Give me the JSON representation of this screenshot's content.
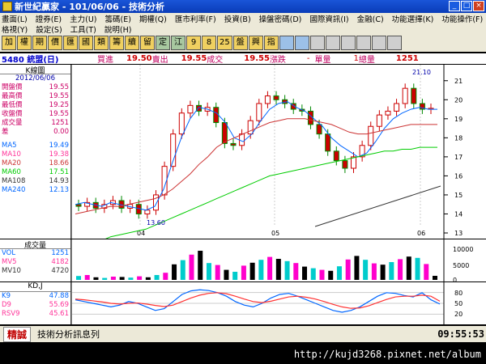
{
  "window": {
    "title": "新世紀贏家 - 101/06/06 - 技術分析"
  },
  "menu": {
    "row1": [
      "畫面(L)",
      "證券(E)",
      "主力(U)",
      "籌碼(E)",
      "期權(Q)",
      "匯市利率(F)",
      "投資(B)",
      "操盤密碼(D)",
      "國際資訊(I)",
      "金融(C)",
      "功能選擇(K)",
      "功能操作(F)"
    ],
    "row2": [
      "格視(Y)",
      "設定(S)",
      "工具(T)",
      "說明(H)"
    ]
  },
  "toolbar": {
    "buttons": [
      "加",
      "權",
      "期",
      "價",
      "匯",
      "國",
      "類",
      "籌",
      "續",
      "留",
      "定",
      "江",
      "9",
      "8",
      "25",
      "盤",
      "興",
      "指"
    ]
  },
  "quote": {
    "code_name": "5480 統盟(日)",
    "buy_label": "買進",
    "buy": "19.50",
    "sell_label": "賣出",
    "sell": "19.55",
    "trade_label": "成交",
    "trade": "19.55",
    "change_label": "漲跌",
    "change": "-",
    "unit_label": "單量",
    "unit": "1",
    "total_label": "總量",
    "total": "1251"
  },
  "kline": {
    "header": "K線圖",
    "date": "2012/06/06",
    "fields": [
      {
        "label": "開盤價",
        "value": "19.55"
      },
      {
        "label": "最高價",
        "value": "19.55"
      },
      {
        "label": "最低價",
        "value": "19.25"
      },
      {
        "label": "收盤價",
        "value": "19.55"
      },
      {
        "label": "成交量",
        "value": "1251"
      },
      {
        "label": "差",
        "value": "0.00"
      }
    ],
    "ma": [
      {
        "label": "MA5",
        "value": "19.49",
        "color": "#0066ff"
      },
      {
        "label": "MA10",
        "value": "19.38",
        "color": "#ff3399"
      },
      {
        "label": "MA20",
        "value": "18.66",
        "color": "#cc3333"
      },
      {
        "label": "MA60",
        "value": "17.51",
        "color": "#00cc00"
      },
      {
        "label": "MA108",
        "value": "14.93",
        "color": "#333333"
      },
      {
        "label": "MA240",
        "value": "12.13",
        "color": "#0066ff"
      }
    ],
    "high_label": "21.10",
    "low_label": "13.60",
    "month_labels": [
      "04",
      "05",
      "06"
    ],
    "y_ticks": [
      "21",
      "20",
      "19",
      "18",
      "17",
      "16",
      "15",
      "14",
      "13"
    ]
  },
  "volume": {
    "header": "成交量",
    "fields": [
      {
        "label": "VOL",
        "value": "1251",
        "color": "#0066ff"
      },
      {
        "label": "MV5",
        "value": "4182",
        "color": "#ff3399"
      },
      {
        "label": "MV10",
        "value": "4720",
        "color": "#333333"
      }
    ],
    "y_ticks": [
      "10000",
      "5000",
      "0"
    ]
  },
  "kd": {
    "header": "KD,J",
    "fields": [
      {
        "label": "K9",
        "value": "47.88",
        "color": "#0066ff"
      },
      {
        "label": "D9",
        "value": "55.69",
        "color": "#ff3399"
      },
      {
        "label": "RSV9",
        "value": "45.61",
        "color": "#ff3399"
      }
    ],
    "y_ticks": [
      "80",
      "50",
      "20"
    ]
  },
  "status": {
    "seal": "精誠",
    "message": "技術分析訊息列",
    "time": "09:55:53"
  },
  "watermark": "http://kujd3268.pixnet.net/album",
  "chart_data": {
    "type": "line",
    "title": "",
    "x": [
      1,
      2,
      3,
      4,
      5,
      6,
      7,
      8,
      9,
      10,
      11,
      12,
      13,
      14,
      15,
      16,
      17,
      18,
      19,
      20,
      21,
      22,
      23,
      24,
      25,
      26,
      27,
      28,
      29,
      30,
      31,
      32,
      33,
      34,
      35,
      36,
      37,
      38,
      39,
      40,
      41,
      42,
      43,
      44,
      45,
      46,
      47,
      48,
      49,
      50
    ],
    "series": [
      {
        "name": "MA5",
        "values": [
          14.5,
          14.6,
          14.5,
          14.4,
          14.6,
          14.5,
          14.4,
          14.3,
          14.2,
          14.4,
          15.3,
          16.7,
          18.0,
          19.0,
          19.6,
          19.5,
          19.3,
          18.8,
          18.0,
          17.8,
          18.2,
          18.9,
          19.5,
          19.8,
          19.9,
          19.6,
          19.4,
          19.0,
          18.6,
          18.0,
          17.6,
          17.3,
          17.0,
          17.2,
          17.8,
          18.5,
          19.0,
          19.3,
          19.5,
          19.6,
          19.5,
          19.5
        ]
      },
      {
        "name": "MA20",
        "values": [
          14.0,
          14.1,
          14.2,
          14.3,
          14.4,
          14.4,
          14.5,
          14.6,
          14.7,
          14.8,
          15.0,
          15.3,
          15.7,
          16.1,
          16.6,
          17.0,
          17.5,
          17.8,
          18.0,
          18.2,
          18.4,
          18.6,
          18.8,
          18.9,
          19.0,
          19.0,
          19.0,
          18.9,
          18.8,
          18.7,
          18.5,
          18.3,
          18.2,
          18.2,
          18.3,
          18.4,
          18.5,
          18.6,
          18.7,
          18.7,
          18.7,
          18.7
        ]
      },
      {
        "name": "MA60",
        "values": [
          12.3,
          12.4,
          12.5,
          12.6,
          12.8,
          12.9,
          13.0,
          13.1,
          13.2,
          13.4,
          13.6,
          13.8,
          14.0,
          14.2,
          14.4,
          14.6,
          14.8,
          15.0,
          15.2,
          15.4,
          15.6,
          15.8,
          16.0,
          16.1,
          16.2,
          16.3,
          16.4,
          16.5,
          16.6,
          16.7,
          16.8,
          16.9,
          17.0,
          17.1,
          17.2,
          17.3,
          17.3,
          17.4,
          17.4,
          17.5,
          17.5,
          17.5
        ]
      }
    ],
    "ylim": [
      13,
      21.5
    ],
    "xlabel": "",
    "ylabel": ""
  }
}
